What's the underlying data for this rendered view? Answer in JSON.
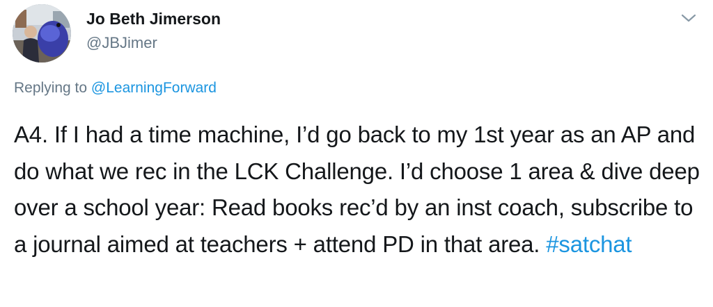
{
  "author": {
    "display_name": "Jo Beth Jimerson",
    "handle": "@JBJimer"
  },
  "reply": {
    "prefix": "Replying to",
    "mention": "@LearningForward"
  },
  "tweet": {
    "text": "A4. If I had a time machine, I’d go back to my 1st year as an AP and do what we rec in the LCK Challenge. I’d choose 1 area & dive deep over a school year: Read books rec’d by an inst coach, subscribe to a journal aimed at teachers + attend PD in that area.",
    "hashtag": "#satchat"
  },
  "icons": {
    "menu": "chevron-down-icon",
    "avatar": "profile-photo"
  },
  "colors": {
    "text": "#14171a",
    "secondary": "#657786",
    "link": "#1b95e0",
    "background": "#ffffff"
  }
}
